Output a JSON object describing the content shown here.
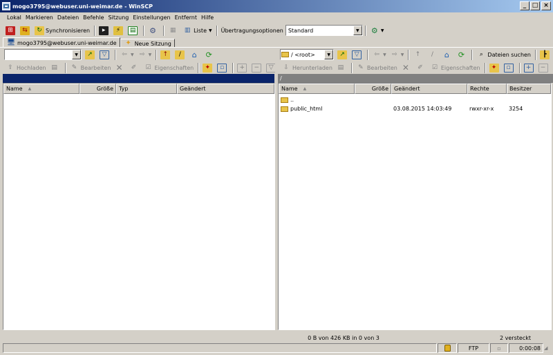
{
  "window": {
    "title": "mogo3795@webuser.uni-weimar.de - WinSCP"
  },
  "menu": [
    "Lokal",
    "Markieren",
    "Dateien",
    "Befehle",
    "Sitzung",
    "Einstellungen",
    "Entfernt",
    "Hilfe"
  ],
  "toolbar": {
    "sync_label": "Synchronisieren",
    "list_label": "Liste",
    "transfer_options_label": "Übertragungsoptionen",
    "transfer_preset": "Standard"
  },
  "tabs": {
    "session": "mogo3795@webuser.uni-weimar.de",
    "new_session": "Neue Sitzung"
  },
  "local": {
    "path": "",
    "upload_label": "Hochladen",
    "edit_label": "Bearbeiten",
    "props_label": "Eigenschaften",
    "columns": [
      "Name",
      "Größe",
      "Typ",
      "Geändert"
    ]
  },
  "remote": {
    "path": "/ <root>",
    "find_label": "Dateien suchen",
    "download_label": "Herunterladen",
    "edit_label": "Bearbeiten",
    "props_label": "Eigenschaften",
    "path_bar": "/",
    "columns": [
      "Name",
      "Größe",
      "Geändert",
      "Rechte",
      "Besitzer"
    ],
    "rows": [
      {
        "name": "..",
        "size": "",
        "changed": "",
        "rights": "",
        "owner": ""
      },
      {
        "name": "public_html",
        "size": "",
        "changed": "03.08.2015 14:03:49",
        "rights": "rwxr-xr-x",
        "owner": "3254"
      }
    ]
  },
  "status": {
    "selection": "0 B von 426 KB in 0 von 3",
    "hidden": "2 versteckt",
    "protocol": "FTP",
    "time": "0:00:08"
  },
  "colors": {
    "title_start": "#0a246a",
    "title_end": "#a6caf0",
    "local_path_bar": "#0a246a",
    "remote_path_bar": "#808080"
  }
}
